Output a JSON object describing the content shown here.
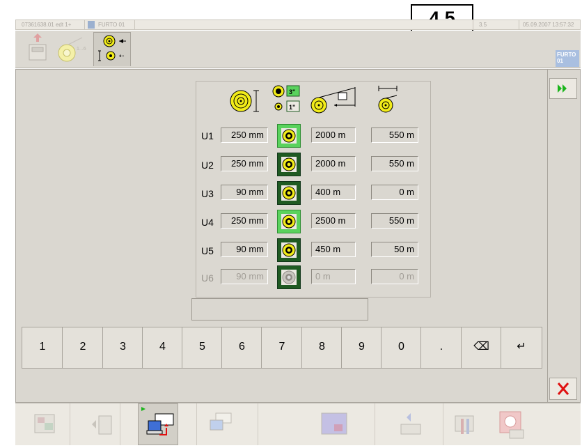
{
  "section_label": "4.5",
  "title_bar": {
    "job_id": "07361638.01 edt 1+",
    "machine_name": "FURTO 01",
    "value": "3.5",
    "datetime": "05.09.2007 13:57:32"
  },
  "toolbar": {
    "items": [
      {
        "icon": "unload-icon"
      },
      {
        "icon": "roll-length-icon"
      },
      {
        "icon": "roll-selection-icon",
        "active": true
      }
    ],
    "badge": "FURTO 01"
  },
  "table": {
    "column_icons": [
      "roll-diameter-icon",
      "core-size-icon",
      "web-length-icon",
      "remaining-length-icon"
    ],
    "core_labels": [
      "3\"",
      "1\""
    ],
    "rows": [
      {
        "label": "U1",
        "diameter": "250 mm",
        "core": "3\"",
        "length": "2000 m",
        "remaining": "550 m",
        "enabled": true
      },
      {
        "label": "U2",
        "diameter": "250 mm",
        "core": "1\"",
        "length": "2000 m",
        "remaining": "550 m",
        "enabled": true
      },
      {
        "label": "U3",
        "diameter": "90 mm",
        "core": "1\"",
        "length": "400 m",
        "remaining": "0 m",
        "enabled": true
      },
      {
        "label": "U4",
        "diameter": "250 mm",
        "core": "3\"",
        "length": "2500 m",
        "remaining": "550 m",
        "enabled": true
      },
      {
        "label": "U5",
        "diameter": "90 mm",
        "core": "1\"",
        "length": "450 m",
        "remaining": "50 m",
        "enabled": true
      },
      {
        "label": "U6",
        "diameter": "90 mm",
        "core": "1\"",
        "length": "0 m",
        "remaining": "0 m",
        "enabled": false
      }
    ]
  },
  "entry_value": "",
  "keypad": [
    "1",
    "2",
    "3",
    "4",
    "5",
    "6",
    "7",
    "8",
    "9",
    "0",
    ".",
    "⌫",
    "↵"
  ],
  "colors": {
    "panel": "#dad7d0",
    "roll_button_dark": "#1f5a22",
    "roll_button_light": "#5ad25d",
    "roll_yellow": "#f2ec1a",
    "close_red": "#e01010",
    "next_green": "#1bb51b"
  },
  "bottom_nav": {
    "items": [
      {
        "icon": "report-icon"
      },
      {
        "icon": "previous-page-icon"
      },
      {
        "icon": "network-upload-icon",
        "active": true
      },
      {
        "icon": "network-download-icon"
      },
      {
        "icon": "screen-icon"
      },
      {
        "icon": "module-icon"
      },
      {
        "icon": "tools-icon"
      },
      {
        "icon": "alarm-icon"
      }
    ]
  }
}
